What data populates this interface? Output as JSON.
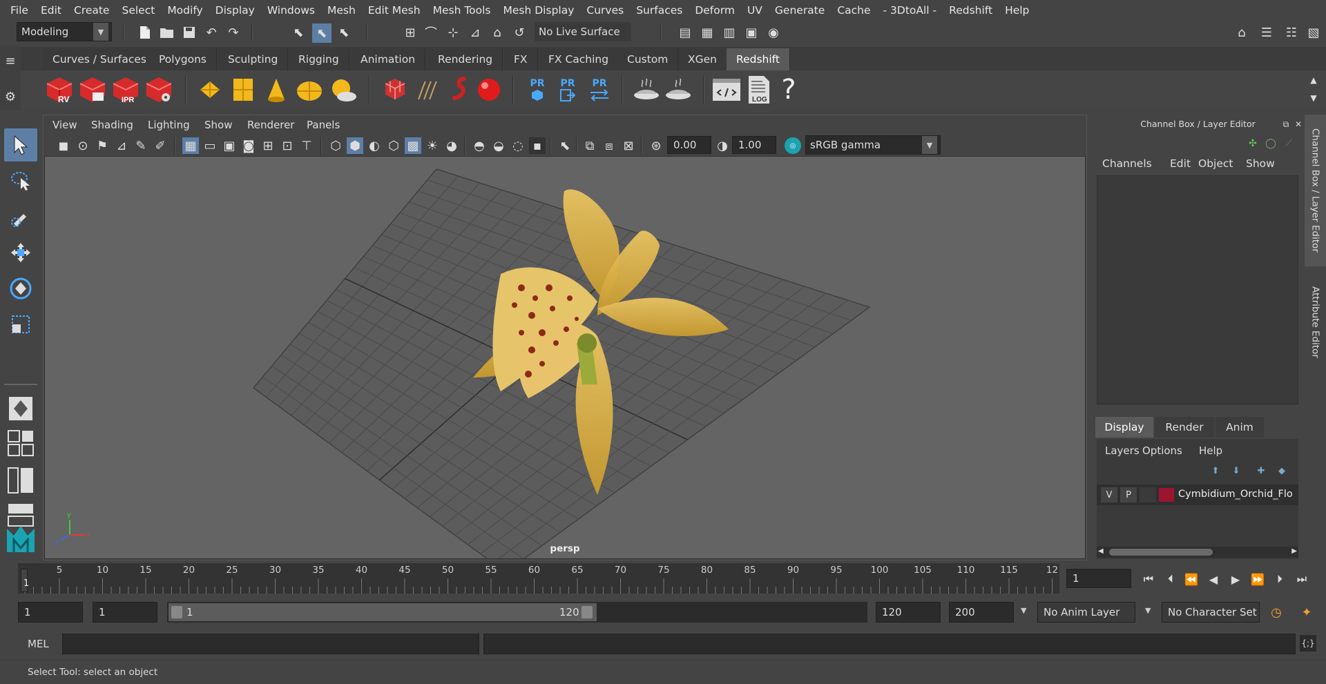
{
  "menubar": [
    "File",
    "Edit",
    "Create",
    "Select",
    "Modify",
    "Display",
    "Windows",
    "Mesh",
    "Edit Mesh",
    "Mesh Tools",
    "Mesh Display",
    "Curves",
    "Surfaces",
    "Deform",
    "UV",
    "Generate",
    "Cache",
    "- 3DtoAll -",
    "Redshift",
    "Help"
  ],
  "statusline": {
    "workspace": "Modeling",
    "live_surface": "No Live Surface"
  },
  "shelf": {
    "tabs": [
      "Curves / Surfaces",
      "Polygons",
      "Sculpting",
      "Rigging",
      "Animation",
      "Rendering",
      "FX",
      "FX Caching",
      "Custom",
      "XGen",
      "Redshift"
    ],
    "active_tab": "Redshift",
    "rv_label": "RV",
    "ipr_label": "IPR",
    "pr_label": "PR",
    "log_label": "LOG",
    "help_glyph": "?"
  },
  "viewport": {
    "menus": [
      "View",
      "Shading",
      "Lighting",
      "Show",
      "Renderer",
      "Panels"
    ],
    "exposure": "0.00",
    "gamma": "1.00",
    "colorspace": "sRGB gamma",
    "camera_label": "persp",
    "axis_y": "y",
    "axis_z": "z",
    "axis_x": "x"
  },
  "channel_box": {
    "title": "Channel Box / Layer Editor",
    "menus": [
      "Channels",
      "Edit",
      "Object",
      "Show"
    ],
    "layer_tabs": [
      "Display",
      "Render",
      "Anim"
    ],
    "active_layer_tab": "Display",
    "layer_menus": [
      "Layers",
      "Options",
      "Help"
    ],
    "layer": {
      "v": "V",
      "p": "P",
      "name": "Cymbidium_Orchid_Flo",
      "color": "#9b1530"
    }
  },
  "side_tabs": [
    "Channel Box / Layer Editor",
    "Attribute Editor"
  ],
  "time_slider": {
    "ticks": [
      "5",
      "10",
      "15",
      "20",
      "25",
      "30",
      "35",
      "40",
      "45",
      "50",
      "55",
      "60",
      "65",
      "70",
      "75",
      "80",
      "85",
      "90",
      "95",
      "100",
      "105",
      "110",
      "115",
      "12"
    ],
    "current_marker": "1",
    "current_frame": "1"
  },
  "range": {
    "start": "1",
    "playback_start": "1",
    "slider_start": "1",
    "slider_end": "120",
    "playback_end": "120",
    "end": "200",
    "anim_layer": "No Anim Layer",
    "character_set": "No Character Set"
  },
  "command": {
    "lang": "MEL"
  },
  "help_line": "Select Tool: select an object"
}
